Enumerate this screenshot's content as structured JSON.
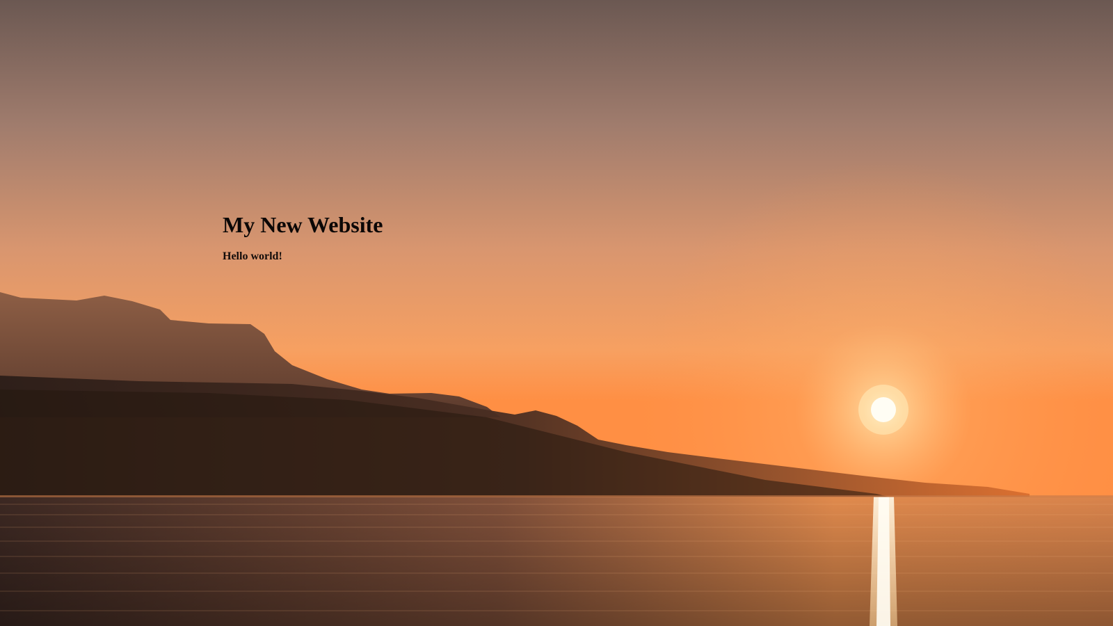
{
  "page": {
    "title": "My New Website",
    "subtitle": "Hello world!"
  },
  "background": {
    "scene": "sunset-over-lake-with-mountains",
    "colors": {
      "sky_top": "#6e5b56",
      "sky_mid": "#b8876f",
      "sky_low": "#f59a55",
      "horizon": "#ff8a3d",
      "sun": "#fffbe8",
      "mountain_far": "#9c6140",
      "mountain_near": "#2a1c17",
      "water_dark": "#3a2620",
      "water_glow": "#e58a4c"
    }
  }
}
